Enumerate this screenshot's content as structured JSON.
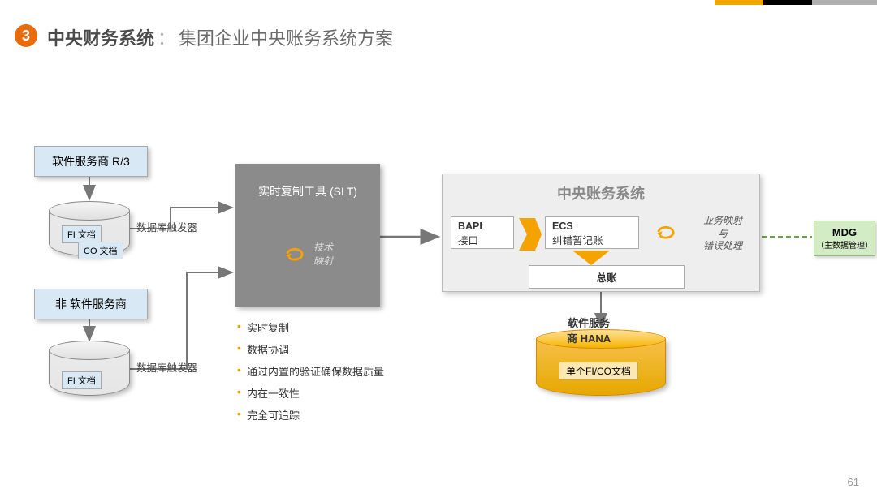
{
  "slide": {
    "badge": "3",
    "title_strong": "中央财务系统",
    "title_separator": "：",
    "title_rest": "集团企业中央账务系统方案",
    "page_number": "61"
  },
  "left": {
    "source_top": "软件服务商 R/3",
    "source_bottom": "非 软件服务商",
    "db_tag_fi": "FI 文档",
    "db_tag_co": "CO 文档",
    "trigger_label": "数据库触发器"
  },
  "slt": {
    "title": "实时复制工具 (SLT)",
    "map_label": "技术\n映射",
    "bullets": [
      "实时复制",
      "数据协调",
      "通过内置的验证确保数据质量",
      "内在一致性",
      "完全可追踪"
    ]
  },
  "central": {
    "panel_title": "中央账务系统",
    "bapi_title": "BAPI",
    "bapi_sub": "接口",
    "ecs_title": "ECS",
    "ecs_sub": "纠错暂记账",
    "gl": "总账",
    "db_title": "软件服务\n商 HANA",
    "db_tag": "单个FI/CO文档",
    "map_line1": "业务映射",
    "map_line2": "与",
    "map_line3": "错误处理"
  },
  "mdg": {
    "title": "MDG",
    "sub": "（主数据管理）"
  }
}
